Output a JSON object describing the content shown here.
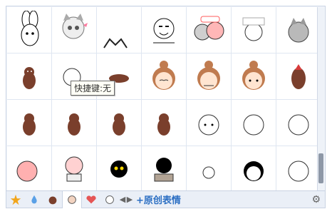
{
  "tooltip": {
    "shortcut_text": "快捷键:无"
  },
  "footer": {
    "prev": "◀",
    "next": "▶",
    "add_label": "+原创表情"
  },
  "stickers": [
    {
      "icon": "rabbit-icon"
    },
    {
      "icon": "cat-icon"
    },
    {
      "icon": "cat-ears-icon"
    },
    {
      "icon": "face-sketch-icon"
    },
    {
      "icon": "fan-girl-icon"
    },
    {
      "icon": "chibi-girl-icon"
    },
    {
      "icon": "cat-grey-icon"
    },
    {
      "icon": "mole-icon"
    },
    {
      "icon": "blob-icon"
    },
    {
      "icon": "mole-lying-icon"
    },
    {
      "icon": "girl-bun-icon"
    },
    {
      "icon": "girl-bun-icon"
    },
    {
      "icon": "girl-bun-icon"
    },
    {
      "icon": "bird-icon"
    },
    {
      "icon": "mole-icon"
    },
    {
      "icon": "mole-icon"
    },
    {
      "icon": "mole-icon"
    },
    {
      "icon": "mole-icon"
    },
    {
      "icon": "bunny-icon"
    },
    {
      "icon": "bunny-icon"
    },
    {
      "icon": "bunny-icon"
    },
    {
      "icon": "pink-girl-icon"
    },
    {
      "icon": "pig-sign-icon"
    },
    {
      "icon": "black-cat-icon"
    },
    {
      "icon": "black-cat-box-icon"
    },
    {
      "icon": "rabbit-small-icon"
    },
    {
      "icon": "black-hair-girl-icon"
    },
    {
      "icon": "bunny-icon"
    }
  ],
  "tabs": [
    {
      "icon": "star-icon"
    },
    {
      "icon": "drop-icon"
    },
    {
      "icon": "mole-tab-icon"
    },
    {
      "icon": "grandpa-icon"
    },
    {
      "icon": "heart-icon"
    },
    {
      "icon": "face-tab-icon"
    }
  ]
}
